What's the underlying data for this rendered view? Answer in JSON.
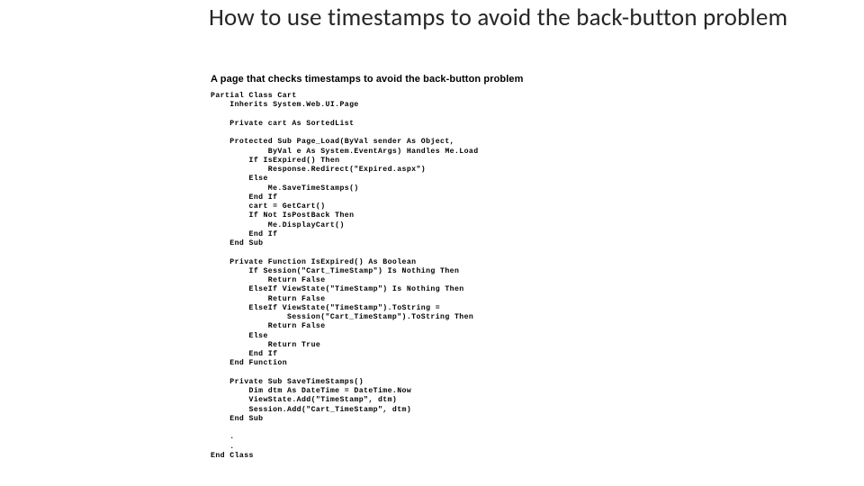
{
  "title": "How to use timestamps to avoid the back-button problem",
  "caption": "A page that checks timestamps to avoid the back-button problem",
  "code": "Partial Class Cart\n    Inherits System.Web.UI.Page\n\n    Private cart As SortedList\n\n    Protected Sub Page_Load(ByVal sender As Object,\n            ByVal e As System.EventArgs) Handles Me.Load\n        If IsExpired() Then\n            Response.Redirect(\"Expired.aspx\")\n        Else\n            Me.SaveTimeStamps()\n        End If\n        cart = GetCart()\n        If Not IsPostBack Then\n            Me.DisplayCart()\n        End If\n    End Sub\n\n    Private Function IsExpired() As Boolean\n        If Session(\"Cart_TimeStamp\") Is Nothing Then\n            Return False\n        ElseIf ViewState(\"TimeStamp\") Is Nothing Then\n            Return False\n        ElseIf ViewState(\"TimeStamp\").ToString =\n                Session(\"Cart_TimeStamp\").ToString Then\n            Return False\n        Else\n            Return True\n        End If\n    End Function\n\n    Private Sub SaveTimeStamps()\n        Dim dtm As DateTime = DateTime.Now\n        ViewState.Add(\"TimeStamp\", dtm)\n        Session.Add(\"Cart_TimeStamp\", dtm)\n    End Sub\n\n    .\n    .\nEnd Class"
}
